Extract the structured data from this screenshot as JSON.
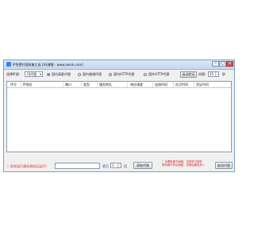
{
  "window": {
    "title": "IP免费代理采集工具 [AS博客 - www.aeink.com]",
    "minimize_glyph": "–",
    "maximize_glyph": "□",
    "close_glyph": "×"
  },
  "toolbar": {
    "source_label": "选择IP源：",
    "source_value": "讯代理",
    "radios": [
      {
        "label": "国内高匿代理",
        "checked": true
      },
      {
        "label": "国内普通代理",
        "checked": false
      },
      {
        "label": "国内HTTP代理",
        "checked": false
      },
      {
        "label": "国外HTTP代理",
        "checked": false
      }
    ],
    "auto_validate_button": "自动验证",
    "interval_label": "间隔：",
    "interval_value": "15",
    "interval_unit": "秒"
  },
  "table": {
    "columns": [
      "序号",
      "IP地址",
      "端口",
      "类型",
      "服务地址",
      "响应速度",
      "连接时间",
      "存活时间",
      "验证时间"
    ]
  },
  "bottom": {
    "hint_left": "！初次运行请先测试后运行！",
    "page_label": "第页",
    "page_value": "1",
    "page_unit": "页",
    "get_proxy_button": "获取代理",
    "red_note_line1": "！代理来源于网络，仅供学习研究",
    "red_note_line2": "请勿用于非法用途，否则后果自负→",
    "cancel_proxy_button": "取消代理"
  },
  "colors": {
    "title_gradient_top": "#dbe8f6",
    "accent_red": "#dd1111",
    "link_blue": "#1a55b5"
  }
}
